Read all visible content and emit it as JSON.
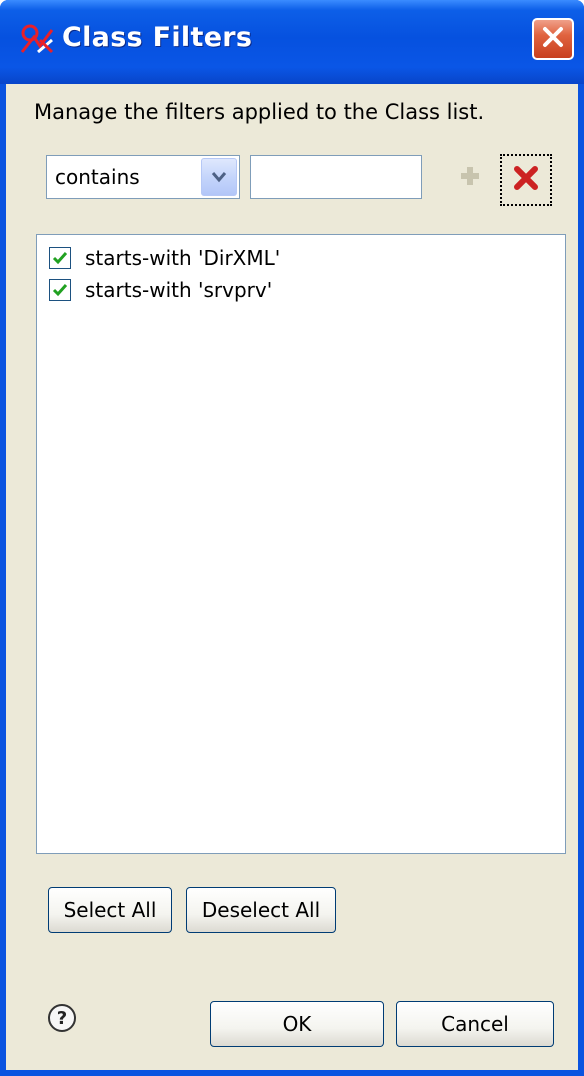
{
  "window": {
    "title": "Class Filters"
  },
  "description": "Manage the filters applied to the Class list.",
  "filter_controls": {
    "match_type": "contains",
    "pattern_value": ""
  },
  "filters": [
    {
      "label": "starts-with 'DirXML'",
      "checked": true
    },
    {
      "label": "starts-with 'srvprv'",
      "checked": true
    }
  ],
  "buttons": {
    "select_all": "Select All",
    "deselect_all": "Deselect All",
    "ok": "OK",
    "cancel": "Cancel"
  },
  "icons": {
    "title": "class-filter-icon",
    "close": "close-icon",
    "dropdown": "chevron-down-icon",
    "add": "plus-icon",
    "remove": "x-icon",
    "help": "help-icon"
  },
  "colors": {
    "titlebar": "#0651df",
    "dialog_bg": "#ece9d8",
    "check": "#21a121",
    "remove": "#cc2222",
    "close_button": "#e0633f"
  }
}
